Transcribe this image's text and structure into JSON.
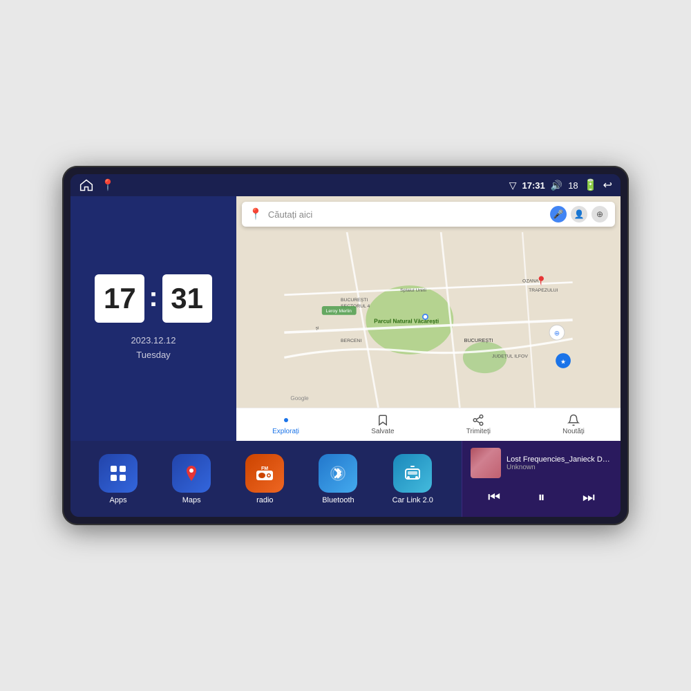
{
  "device": {
    "status_bar": {
      "time": "17:31",
      "signal_bars": "18",
      "home_label": "home",
      "maps_label": "maps"
    },
    "clock": {
      "hour": "17",
      "minute": "31",
      "date": "2023.12.12",
      "day": "Tuesday"
    },
    "map": {
      "search_placeholder": "Căutați aici",
      "nav_items": [
        {
          "label": "Explorați",
          "active": true
        },
        {
          "label": "Salvate",
          "active": false
        },
        {
          "label": "Trimiteți",
          "active": false
        },
        {
          "label": "Noutăți",
          "active": false
        }
      ]
    },
    "apps": [
      {
        "label": "Apps",
        "icon": "apps",
        "color": "#3355cc"
      },
      {
        "label": "Maps",
        "icon": "maps",
        "color": "#3355cc"
      },
      {
        "label": "radio",
        "icon": "radio",
        "color": "#e8550a"
      },
      {
        "label": "Bluetooth",
        "icon": "bluetooth",
        "color": "#4499ee"
      },
      {
        "label": "Car Link 2.0",
        "icon": "carlink",
        "color": "#44aadd"
      }
    ],
    "music": {
      "title": "Lost Frequencies_Janieck Devy-...",
      "artist": "Unknown",
      "prev_label": "previous",
      "play_label": "play/pause",
      "next_label": "next"
    }
  }
}
